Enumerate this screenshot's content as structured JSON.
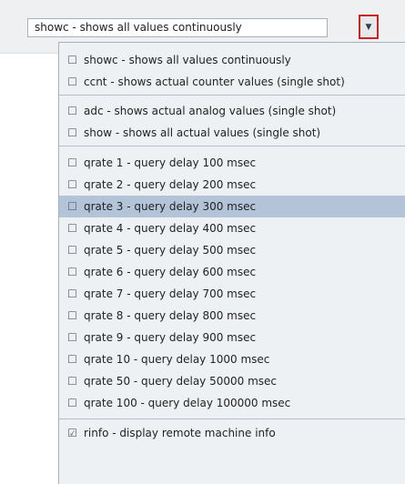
{
  "combo": {
    "value": "showc - shows all values continuously",
    "button_icon": "▼"
  },
  "menu": {
    "check_off": "☐",
    "check_on": "☑",
    "items": [
      {
        "label": "showc - shows all values continuously",
        "checked": false
      },
      {
        "label": "ccnt - shows actual counter values (single shot)",
        "checked": false
      },
      {
        "label": "adc - shows actual analog values (single shot)",
        "checked": false
      },
      {
        "label": "show - shows all actual values (single shot)",
        "checked": false
      },
      {
        "label": "qrate 1 - query delay 100 msec",
        "checked": false
      },
      {
        "label": "qrate 2 - query delay 200 msec",
        "checked": false
      },
      {
        "label": "qrate 3 - query delay 300 msec",
        "checked": false,
        "selected": true
      },
      {
        "label": "qrate 4 - query delay 400 msec",
        "checked": false
      },
      {
        "label": "qrate 5 - query delay 500 msec",
        "checked": false
      },
      {
        "label": "qrate 6 - query delay 600 msec",
        "checked": false
      },
      {
        "label": "qrate 7 - query delay 700 msec",
        "checked": false
      },
      {
        "label": "qrate 8 - query delay 800 msec",
        "checked": false
      },
      {
        "label": "qrate 9 - query delay 900 msec",
        "checked": false
      },
      {
        "label": "qrate 10 - query delay 1000 msec",
        "checked": false
      },
      {
        "label": "qrate 50 - query delay 50000 msec",
        "checked": false
      },
      {
        "label": "qrate 100 - query delay 100000 msec",
        "checked": false
      },
      {
        "label": "rinfo  - display remote machine info",
        "checked": true
      }
    ]
  }
}
